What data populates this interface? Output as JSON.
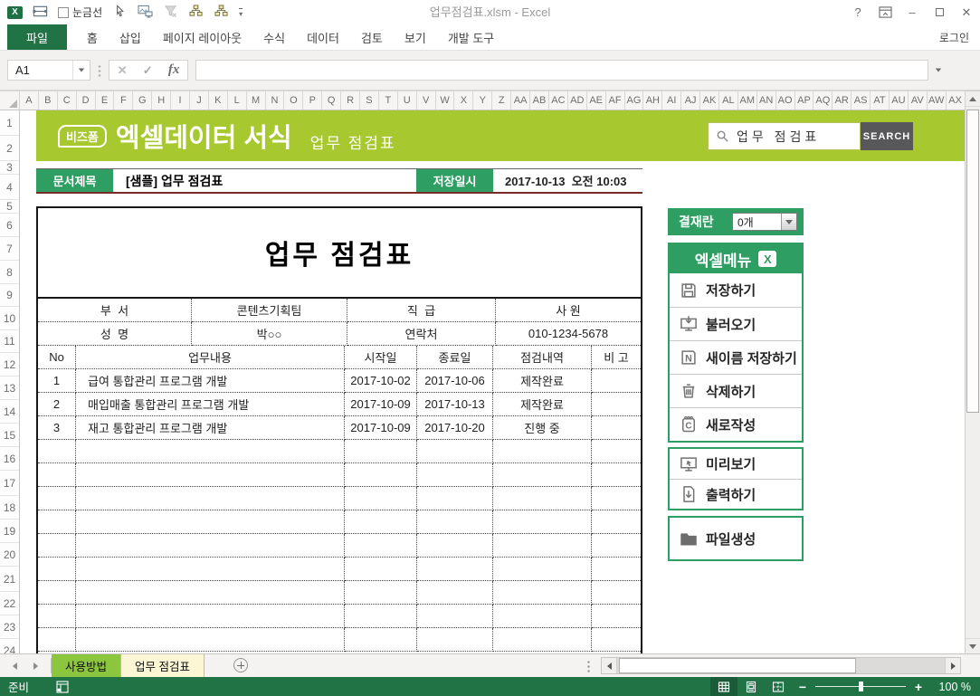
{
  "window": {
    "title": "업무점검표.xlsm - Excel",
    "gridlines_label": "눈금선",
    "qat_icons": [
      "excel-logo-icon",
      "form-window-icon",
      "gridlines-checkbox",
      "cursor-icon",
      "screenshot-icon",
      "filter-clear-icon",
      "org-chart-icon",
      "org-chart2-icon",
      "qat-more-icon"
    ],
    "controls": {
      "help": "?",
      "minimize": "–",
      "close": "✕"
    }
  },
  "ribbon": {
    "file_label": "파일",
    "tabs": [
      "홈",
      "삽입",
      "페이지 레이아웃",
      "수식",
      "데이터",
      "검토",
      "보기",
      "개발 도구"
    ],
    "login_label": "로그인"
  },
  "formula_bar": {
    "cell_reference": "A1",
    "cancel_glyph": "✕",
    "enter_glyph": "✓",
    "fx_label": "fx",
    "formula_value": ""
  },
  "grid": {
    "columns": [
      "A",
      "B",
      "C",
      "D",
      "E",
      "F",
      "G",
      "H",
      "I",
      "J",
      "K",
      "L",
      "M",
      "N",
      "O",
      "P",
      "Q",
      "R",
      "S",
      "T",
      "U",
      "V",
      "W",
      "X",
      "Y",
      "Z",
      "AA",
      "AB",
      "AC",
      "AD",
      "AE",
      "AF",
      "AG",
      "AH",
      "AI",
      "AJ",
      "AK",
      "AL",
      "AM",
      "AN",
      "AO",
      "AP",
      "AQ",
      "AR",
      "AS",
      "AT",
      "AU",
      "AV",
      "AW",
      "AX"
    ],
    "rows": [
      "1",
      "2",
      "3",
      "4",
      "5",
      "6",
      "7",
      "8",
      "9",
      "10",
      "11",
      "12",
      "13",
      "14",
      "15",
      "16",
      "17",
      "18",
      "19",
      "20",
      "21",
      "22",
      "23",
      "24"
    ]
  },
  "banner": {
    "brand": "비즈폼",
    "title": "엑셀데이터 서식",
    "subtitle": "업무 점검표",
    "search": {
      "value": "업무 점검표",
      "button": "SEARCH",
      "icon": "search-icon"
    },
    "background": "#a7c82f"
  },
  "doc_header": {
    "label": "문서제목",
    "value": "[샘플] 업무 점검표",
    "date_label": "저장일시",
    "date_value": "2017-10-13  오전 10:03",
    "badge_color": "#2f9e63"
  },
  "checklist": {
    "title": "업무 점검표",
    "info_rows": [
      [
        "부  서",
        "콘텐츠기획팀",
        "직  급",
        "사 원"
      ],
      [
        "성  명",
        "박○○",
        "연락처",
        "010-1234-5678"
      ]
    ],
    "headers": [
      "No",
      "업무내용",
      "시작일",
      "종료일",
      "점검내역",
      "비 고"
    ],
    "rows": [
      [
        "1",
        "급여 통합관리 프로그램 개발",
        "2017-10-02",
        "2017-10-06",
        "제작완료",
        ""
      ],
      [
        "2",
        "매입매출 통합관리 프로그램 개발",
        "2017-10-09",
        "2017-10-13",
        "제작완료",
        ""
      ],
      [
        "3",
        "재고 통합관리 프로그램 개발",
        "2017-10-09",
        "2017-10-20",
        "진행 중",
        ""
      ]
    ],
    "empty_row_count": 9
  },
  "sidebar": {
    "approval": {
      "label": "결재란",
      "value": "0개"
    },
    "menu_title": "엑셀메뉴",
    "menu_title_icon": "excel-menu-icon",
    "accent_color": "#2f9e63",
    "groups": [
      [
        {
          "icon": "save-icon",
          "label": "저장하기"
        },
        {
          "icon": "load-icon",
          "label": "불러오기"
        },
        {
          "icon": "save-as-icon",
          "label": "새이름 저장하기"
        },
        {
          "icon": "delete-icon",
          "label": "삭제하기"
        },
        {
          "icon": "new-doc-icon",
          "label": "새로작성"
        }
      ],
      [
        {
          "icon": "preview-icon",
          "label": "미리보기"
        },
        {
          "icon": "print-icon",
          "label": "출력하기"
        }
      ],
      [
        {
          "icon": "file-create-icon",
          "label": "파일생성"
        }
      ]
    ]
  },
  "sheet_tabs": {
    "tabs": [
      {
        "label": "사용방법",
        "tab_color": "#8cc63e",
        "active": false
      },
      {
        "label": "업무 점검표",
        "tab_color": "#fdf6d5",
        "active": true
      }
    ]
  },
  "status_bar": {
    "ready": "준비",
    "macro_icon": "macro-record-icon",
    "view_icons": [
      "normal-view-icon",
      "page-layout-view-icon",
      "page-break-view-icon"
    ],
    "zoom_out": "−",
    "zoom_in": "+",
    "zoom": "100 %",
    "background": "#217346"
  }
}
